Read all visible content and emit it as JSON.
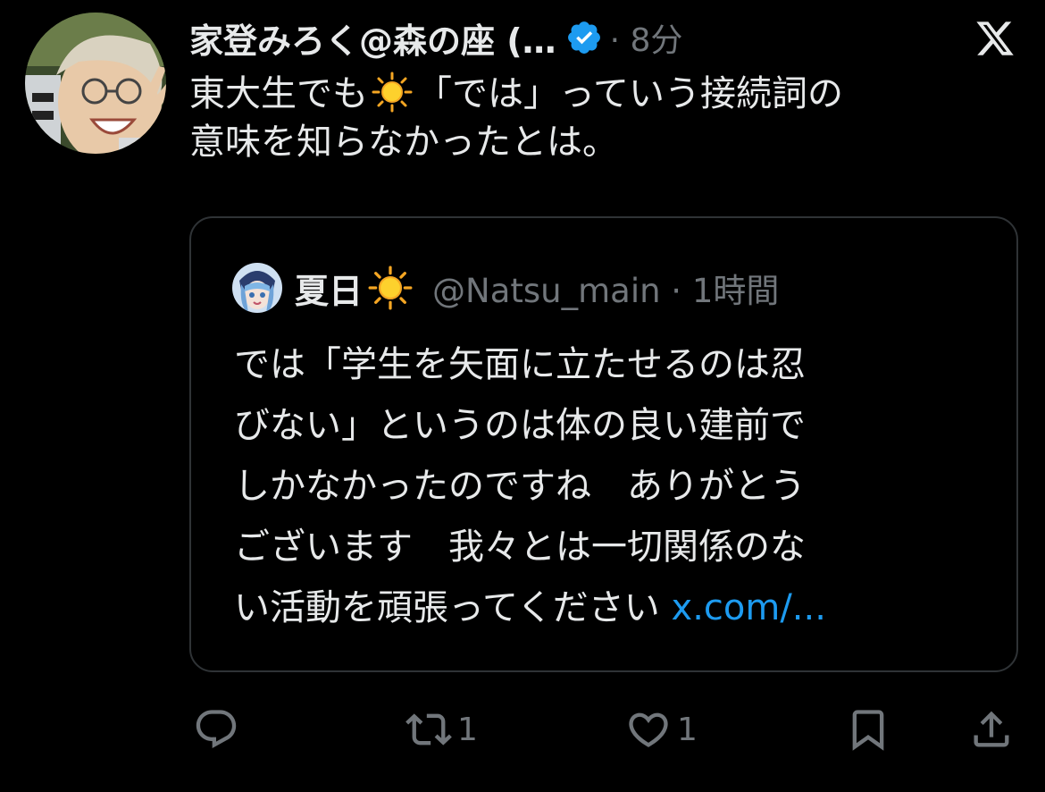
{
  "tweet": {
    "author_name": "家登みろく@森の座 (…",
    "time": "· 8分",
    "text_line1_a": "東大生でも",
    "text_line1_b": "「では」っていう接続詞の",
    "text_line2": "意味を知らなかったとは。"
  },
  "quote": {
    "author_name": "夏日",
    "handle_time": "@Natsu_main · 1時間",
    "lines": [
      "では「学生を矢面に立たせるのは忍",
      "びない」というのは体の良い建前で",
      "しかなかったのですね　ありがとう",
      "ございます　我々とは一切関係のな"
    ],
    "last_line": "い活動を頑張ってください ",
    "link": "x.com/..."
  },
  "actions": {
    "retweet_count": "1",
    "like_count": "1"
  },
  "colors": {
    "background": "#000000",
    "text": "#e7e9ea",
    "muted": "#71767b",
    "link": "#1d9bf0",
    "border": "#2f3336",
    "verified": "#1d9bf0"
  },
  "icons": [
    "avatar",
    "verified-badge-icon",
    "x-logo-icon",
    "sun-emoji-icon",
    "reply-icon",
    "retweet-icon",
    "like-icon",
    "bookmark-icon",
    "share-icon"
  ]
}
